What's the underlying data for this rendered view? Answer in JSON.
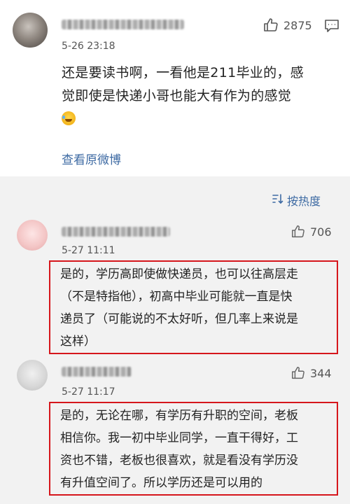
{
  "main_comment": {
    "time": "5-26 23:18",
    "likes": "2875",
    "text_line1": "还是要读书啊，一看他是211毕业的，感",
    "text_line2": "觉即使是快递小哥也能大有作为的感觉",
    "view_original": "查看原微博"
  },
  "sort": {
    "label": "按热度"
  },
  "replies": [
    {
      "time": "5-27 11:11",
      "likes": "706",
      "lines": [
        "是的，学历高即使做快递员，也可以往高层走",
        "（不是特指他），初高中毕业可能就一直是快",
        "递员了（可能说的不太好听，但几率上来说是",
        "这样）"
      ]
    },
    {
      "time": "5-27 11:17",
      "likes": "344",
      "lines": [
        "是的，无论在哪，有学历有升职的空间，老板",
        "相信你。我一初中毕业同学，一直干得好，工",
        "资也不错，老板也很喜欢，就是看没有学历没",
        "有升值空间了。所以学历还是可以用的"
      ]
    }
  ],
  "colors": {
    "link": "#3d6aa3",
    "highlight_border": "#d6161c",
    "reply_background": "#f2f2f2"
  }
}
